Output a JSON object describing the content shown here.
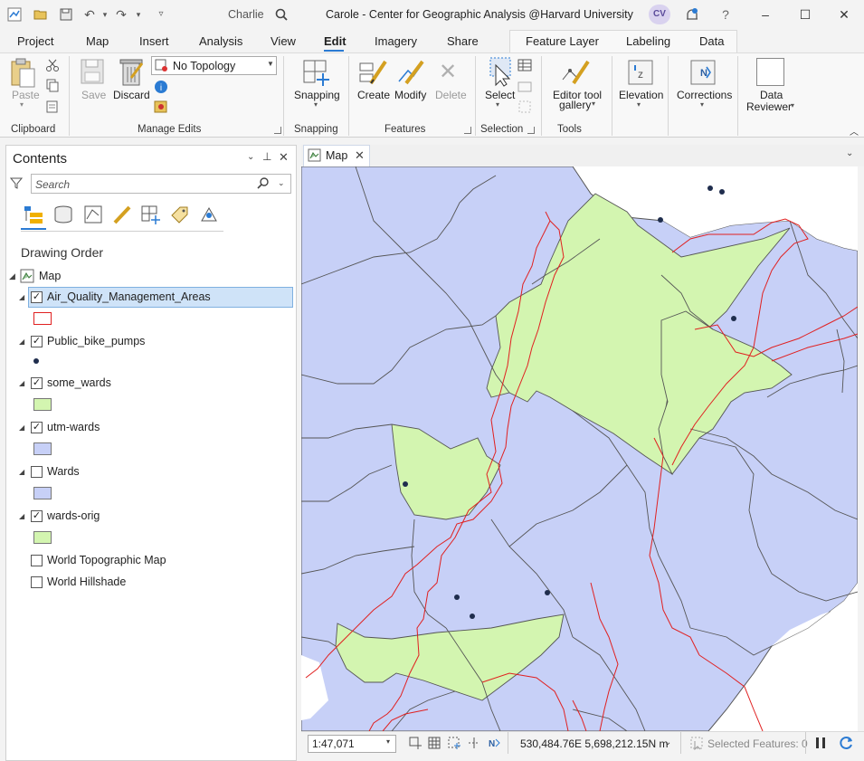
{
  "titlebar": {
    "user": "Charlie",
    "title": "Carole - Center for Geographic Analysis @Harvard University",
    "avatar_initials": "CV"
  },
  "ribbon_tabs": [
    "Project",
    "Map",
    "Insert",
    "Analysis",
    "View",
    "Edit",
    "Imagery",
    "Share"
  ],
  "active_tab": "Edit",
  "contextual_tabs": [
    "Feature Layer",
    "Labeling",
    "Data"
  ],
  "ribbon": {
    "clipboard": {
      "paste": "Paste",
      "group": "Clipboard"
    },
    "manage_edits": {
      "save": "Save",
      "discard": "Discard",
      "topology": "No Topology",
      "group": "Manage Edits"
    },
    "snapping": {
      "button": "Snapping",
      "group": "Snapping"
    },
    "features": {
      "create": "Create",
      "modify": "Modify",
      "delete": "Delete",
      "group": "Features"
    },
    "selection": {
      "select": "Select",
      "group": "Selection"
    },
    "tools": {
      "gallery_line1": "Editor tool",
      "gallery_line2": "gallery",
      "group": "Tools"
    },
    "elevation": "Elevation",
    "corrections": "Corrections",
    "data_reviewer_line1": "Data",
    "data_reviewer_line2": "Reviewer"
  },
  "contents": {
    "title": "Contents",
    "search_placeholder": "Search",
    "section": "Drawing Order",
    "map_node": "Map",
    "layers": [
      {
        "name": "Air_Quality_Management_Areas",
        "checked": true,
        "selected": true,
        "symbol": "outline",
        "color": "#e02020"
      },
      {
        "name": "Public_bike_pumps",
        "checked": true,
        "symbol": "point",
        "color": "#1f2d4d"
      },
      {
        "name": "some_wards",
        "checked": true,
        "symbol": "fill",
        "color": "#d3f5b0"
      },
      {
        "name": "utm-wards",
        "checked": true,
        "symbol": "fill",
        "color": "#c7d0f7"
      },
      {
        "name": "Wards",
        "checked": false,
        "symbol": "fill",
        "color": "#c7d0f7"
      },
      {
        "name": "wards-orig",
        "checked": true,
        "symbol": "fill",
        "color": "#d3f5b0"
      },
      {
        "name": "World Topographic Map",
        "checked": false,
        "symbol": "none"
      },
      {
        "name": "World Hillshade",
        "checked": false,
        "symbol": "none"
      }
    ]
  },
  "map": {
    "tab_label": "Map",
    "colors": {
      "ward_fill": "#c7d0f7",
      "green_fill": "#d3f5b0",
      "aqma_line": "#e02020",
      "outline": "#555555",
      "pump": "#1f2d4d"
    }
  },
  "status": {
    "scale": "1:47,071",
    "coordinates": "530,484.76E 5,698,212.15N m",
    "selected_features": "Selected Features: 0"
  }
}
